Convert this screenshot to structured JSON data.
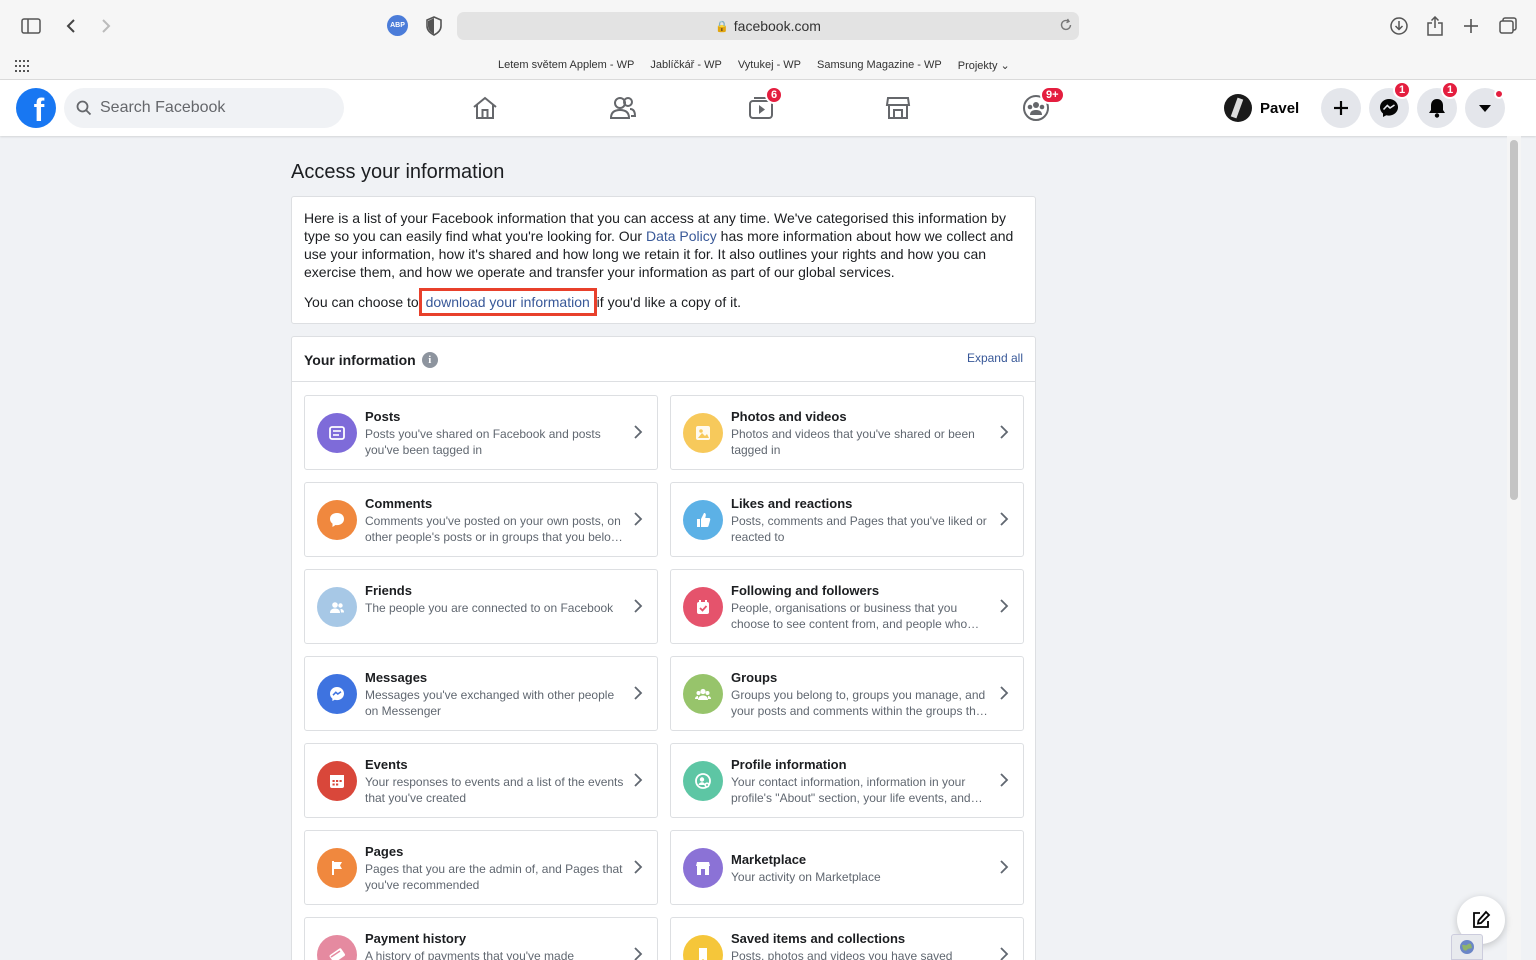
{
  "browser": {
    "url": "facebook.com",
    "extension_abp": "ABP",
    "bookmarks": [
      "Letem světem Applem - WP",
      "Jablíčkář - WP",
      "Vytukej - WP",
      "Samsung Magazine - WP",
      "Projekty ⌄"
    ]
  },
  "header": {
    "logo_letter": "f",
    "search_placeholder": "Search Facebook",
    "watch_badge": "6",
    "groups_badge": "9+",
    "profile_name": "Pavel",
    "messenger_badge": "1",
    "notifications_badge": "1",
    "colors": {
      "brand": "#1877f2",
      "badge": "#e41e3f"
    }
  },
  "page": {
    "title": "Access your information",
    "intro_part1": "Here is a list of your Facebook information that you can access at any time. We've categorised this information by type so you can easily find what you're looking for. Our ",
    "data_policy_link": "Data Policy",
    "intro_part2": " has more information about how we collect and use your information, how it's shared and how long we retain it for. It also outlines your rights and how you can exercise them, and how we operate and transfer your information as part of our global services.",
    "choose_prefix": "You can choose to ",
    "download_link": "download your information",
    "choose_suffix": " if you'd like a copy of it.",
    "section_title": "Your information",
    "info_icon": "i",
    "expand_all": "Expand all"
  },
  "tiles": [
    {
      "title": "Posts",
      "desc": "Posts you've shared on Facebook and posts you've been tagged in",
      "icon": "posts-icon",
      "color": "#7e6bd9"
    },
    {
      "title": "Photos and videos",
      "desc": "Photos and videos that you've shared or been tagged in",
      "icon": "photos-icon",
      "color": "#f7c95b"
    },
    {
      "title": "Comments",
      "desc": "Comments you've posted on your own posts, on other people's posts or in groups that you belong to",
      "icon": "comment-icon",
      "color": "#f0883e"
    },
    {
      "title": "Likes and reactions",
      "desc": "Posts, comments and Pages that you've liked or reacted to",
      "icon": "like-icon",
      "color": "#5cb1e6"
    },
    {
      "title": "Friends",
      "desc": "The people you are connected to on Facebook",
      "icon": "friends-icon",
      "color": "#a7c8e6"
    },
    {
      "title": "Following and followers",
      "desc": "People, organisations or business that you choose to see content from, and people who follow you",
      "icon": "following-icon",
      "color": "#e5536c"
    },
    {
      "title": "Messages",
      "desc": "Messages you've exchanged with other people on Messenger",
      "icon": "messenger-icon",
      "color": "#3e73e0"
    },
    {
      "title": "Groups",
      "desc": "Groups you belong to, groups you manage, and your posts and comments within the groups that you belong to",
      "icon": "groups-icon",
      "color": "#97c46b"
    },
    {
      "title": "Events",
      "desc": "Your responses to events and a list of the events that you've created",
      "icon": "calendar-icon",
      "color": "#d9473a"
    },
    {
      "title": "Profile information",
      "desc": "Your contact information, information in your profile's \"About\" section, your life events, and more",
      "icon": "profile-icon",
      "color": "#5dc6a4"
    },
    {
      "title": "Pages",
      "desc": "Pages that you are the admin of, and Pages that you've recommended",
      "icon": "flag-icon",
      "color": "#f0883e"
    },
    {
      "title": "Marketplace",
      "desc": "Your activity on Marketplace",
      "icon": "store-icon",
      "color": "#8b72d6"
    },
    {
      "title": "Payment history",
      "desc": "A history of payments that you've made",
      "icon": "payment-icon",
      "color": "#e58aa0"
    },
    {
      "title": "Saved items and collections",
      "desc": "Posts, photos and videos you have saved",
      "icon": "bookmark-icon",
      "color": "#f5c63a"
    }
  ]
}
